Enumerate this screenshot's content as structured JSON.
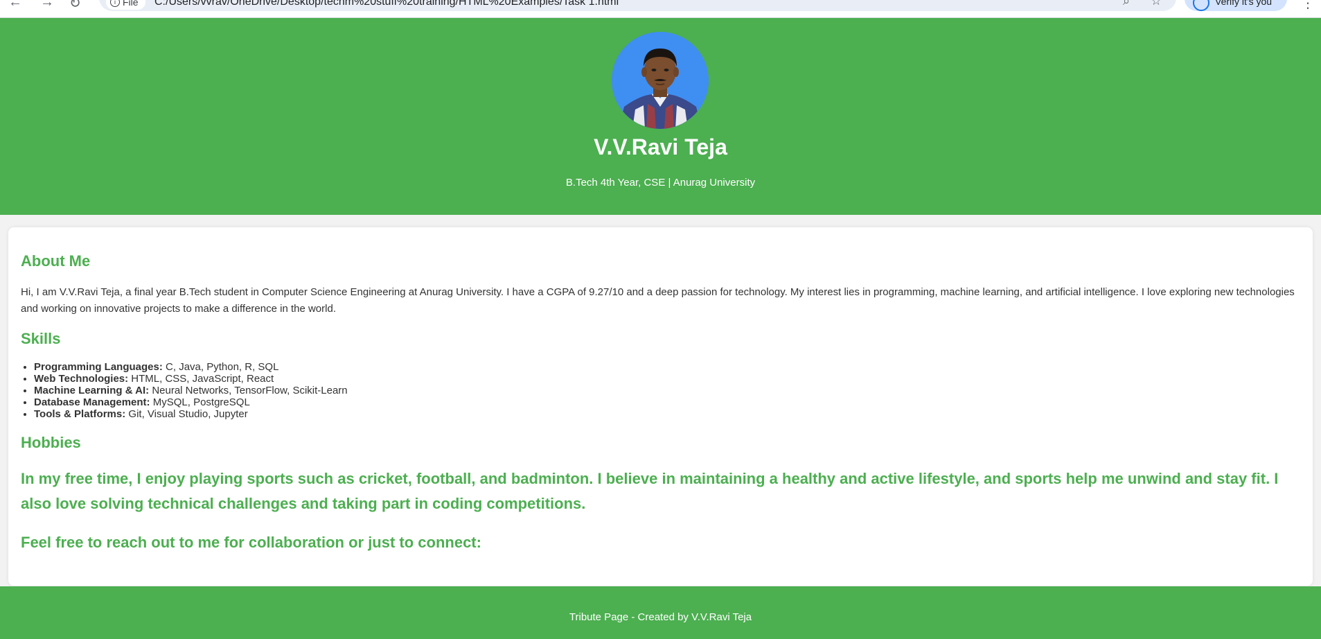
{
  "browser": {
    "site_label": "File",
    "url": "C:/Users/vvrav/OneDrive/Desktop/techm%20stuff%20training/HTML%20Examples/Task 1.html",
    "profile_label": "Verify it's you"
  },
  "header": {
    "name": "V.V.Ravi Teja",
    "subtitle": "B.Tech 4th Year, CSE | Anurag University"
  },
  "about": {
    "heading": "About Me",
    "text": "Hi, I am V.V.Ravi Teja, a final year B.Tech student in Computer Science Engineering at Anurag University. I have a CGPA of 9.27/10 and a deep passion for technology. My interest lies in programming, machine learning, and artificial intelligence. I love exploring new technologies and working on innovative projects to make a difference in the world."
  },
  "skills": {
    "heading": "Skills",
    "items": [
      {
        "label": "Programming Languages:",
        "value": "C, Java, Python, R, SQL"
      },
      {
        "label": "Web Technologies:",
        "value": "HTML, CSS, JavaScript, React"
      },
      {
        "label": "Machine Learning & AI:",
        "value": "Neural Networks, TensorFlow, Scikit-Learn"
      },
      {
        "label": "Database Management:",
        "value": "MySQL, PostgreSQL"
      },
      {
        "label": "Tools & Platforms:",
        "value": "Git, Visual Studio, Jupyter"
      }
    ]
  },
  "hobbies": {
    "heading": "Hobbies",
    "text": "In my free time, I enjoy playing sports such as cricket, football, and badminton. I believe in maintaining a healthy and active lifestyle, and sports help me unwind and stay fit. I also love solving technical challenges and taking part in coding competitions."
  },
  "contact": {
    "text": "Feel free to reach out to me for collaboration or just to connect:"
  },
  "footer": {
    "text": "Tribute Page - Created by V.V.Ravi Teja"
  },
  "colors": {
    "brand_green": "#4caf50",
    "page_background": "#f2f2f2",
    "card_background": "#ffffff",
    "body_text": "#333333"
  }
}
